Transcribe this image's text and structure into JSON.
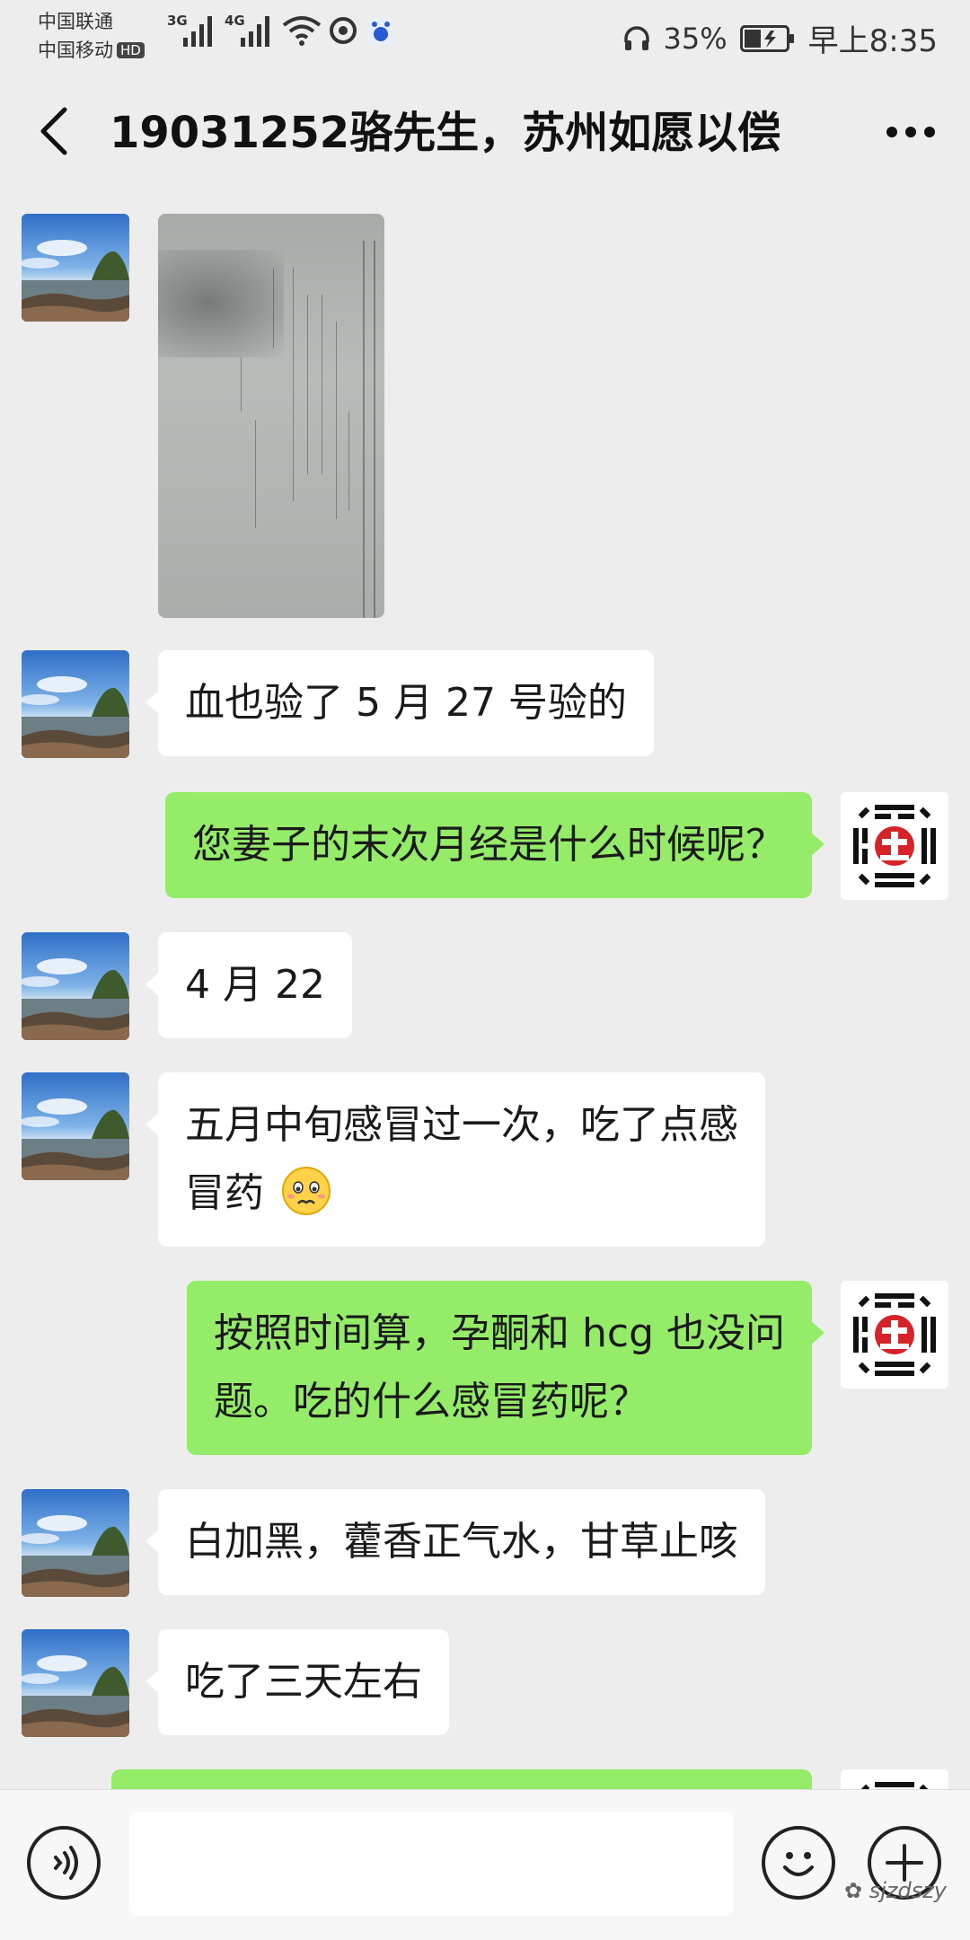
{
  "status_bar": {
    "carrier_1": "中国联通",
    "carrier_2": "中国移动",
    "hd": "HD",
    "net_1": "3G",
    "net_2": "4G",
    "battery": "35%",
    "time": "早上8:35"
  },
  "header": {
    "title": "19031252骆先生，苏州如愿以偿"
  },
  "messages": [
    {
      "side": "in",
      "type": "image"
    },
    {
      "side": "in",
      "text": "血也验了 5 月 27 号验的"
    },
    {
      "side": "out",
      "text": "您妻子的末次月经是什么时候呢？"
    },
    {
      "side": "in",
      "text": "4 月 22"
    },
    {
      "side": "in",
      "text": "五月中旬感冒过一次，吃了点感",
      "text2": "冒药"
    },
    {
      "side": "out",
      "text": "按照时间算，孕酮和 hcg 也没问",
      "text2": "题。吃的什么感冒药呢？"
    },
    {
      "side": "in",
      "text": "白加黑，藿香正气水，甘草止咳"
    },
    {
      "side": "in",
      "text": "吃了三天左右"
    },
    {
      "side": "out",
      "type": "partial"
    }
  ],
  "input_bar": {
    "placeholder": "",
    "watermark": "sjzdszy"
  },
  "colors": {
    "background": "#ededed",
    "outgoing_bubble": "#95ec69",
    "incoming_bubble": "#ffffff"
  },
  "icons": [
    "back-arrow-icon",
    "more-icon",
    "voice-icon",
    "emoji-icon",
    "plus-icon",
    "headphone-icon",
    "battery-icon",
    "wifi-icon",
    "signal-icon"
  ]
}
